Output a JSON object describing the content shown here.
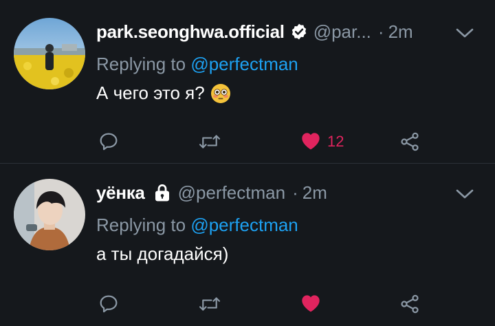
{
  "tweets": [
    {
      "author_name": "park.seonghwa.official",
      "handle": "@par...",
      "separator": "·",
      "time": "2m",
      "verified": true,
      "replying_prefix": "Replying to",
      "replying_handle": "@perfectman",
      "text": "А чего это я?",
      "emoji": "flushed-face",
      "like_count": "12",
      "liked": true
    },
    {
      "author_name": "уёнка",
      "handle": "@perfectman",
      "separator": "·",
      "time": "2m",
      "protected": true,
      "replying_prefix": "Replying to",
      "replying_handle": "@perfectman",
      "text": "а ты догадайся)",
      "like_count": "",
      "liked": true
    }
  ],
  "colors": {
    "background": "#15181c",
    "secondary_text": "#8b98a5",
    "link": "#1da1f2",
    "like": "#e0245e"
  },
  "icons": [
    "reply-icon",
    "retweet-icon",
    "like-icon",
    "share-icon",
    "chevron-down-icon",
    "verified-badge-icon",
    "lock-icon"
  ]
}
